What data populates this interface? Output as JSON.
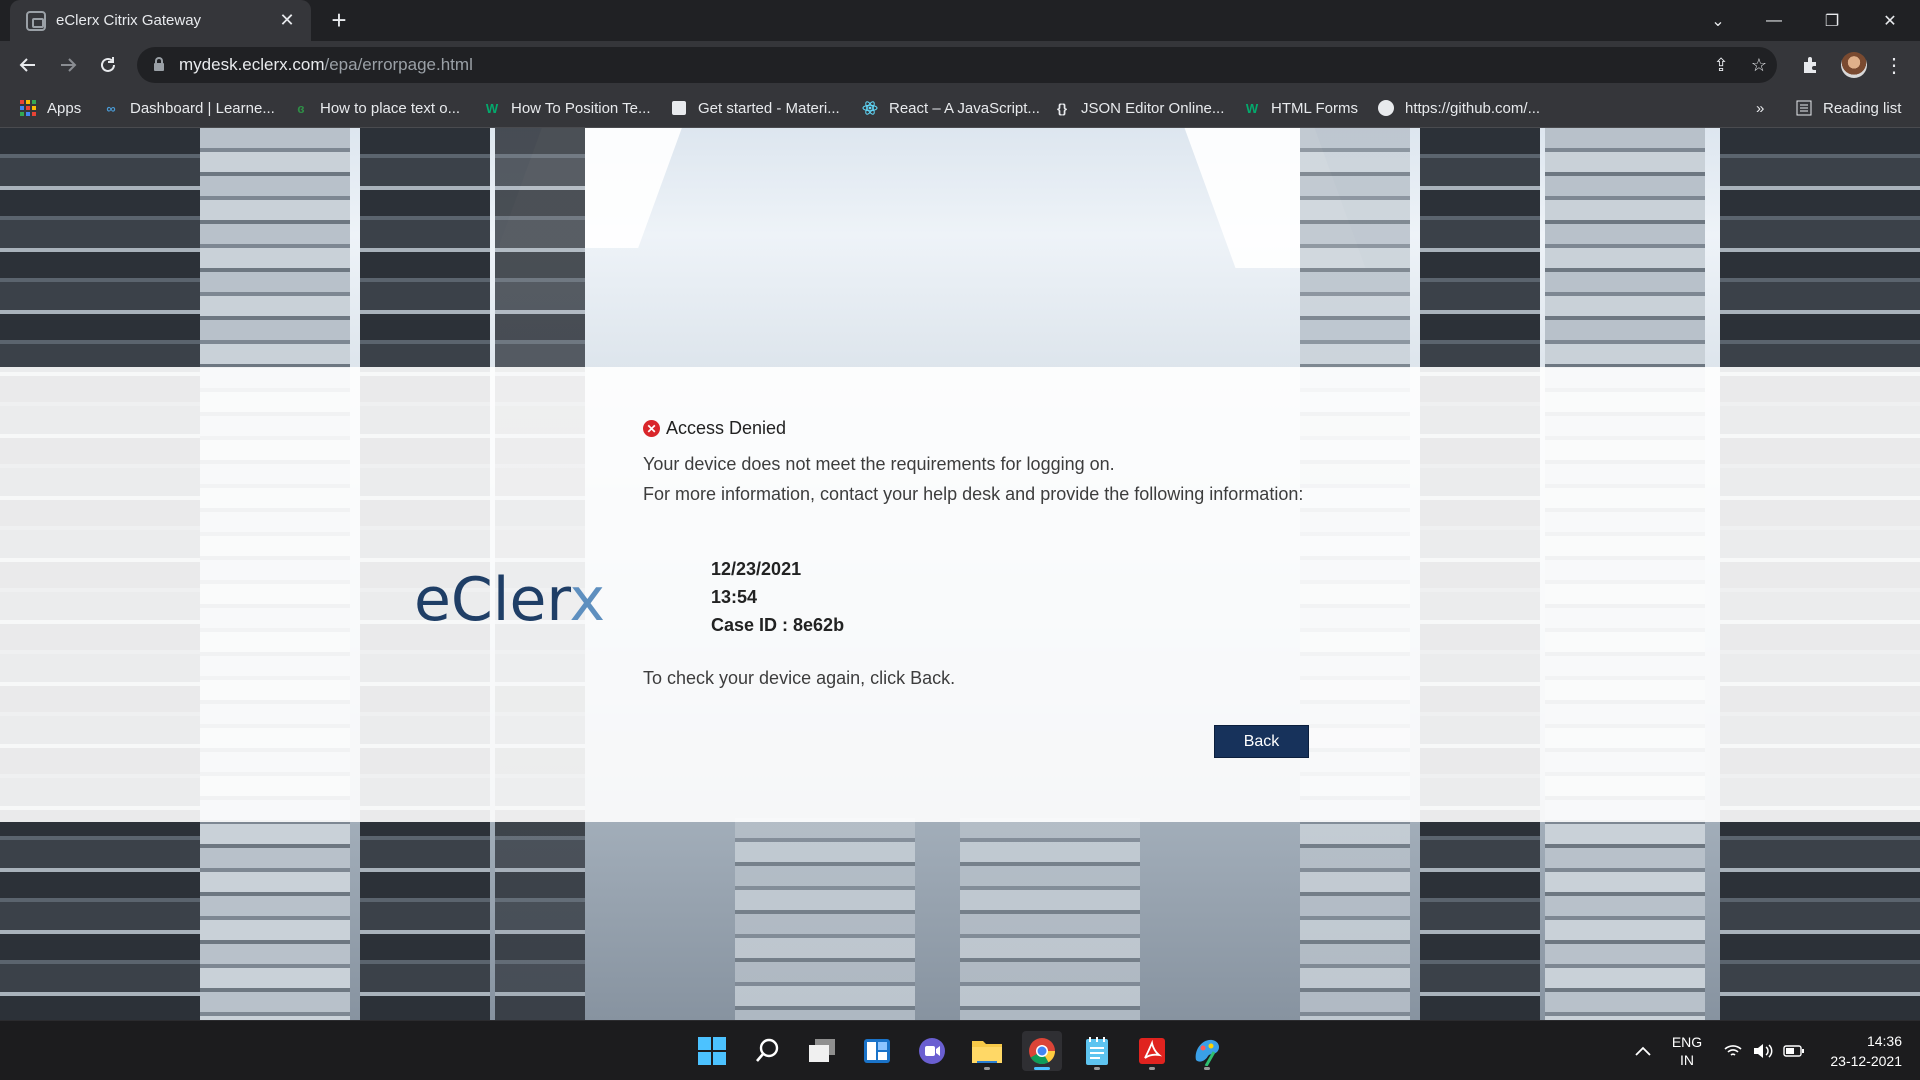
{
  "browser": {
    "tab_title": "eClerx Citrix Gateway",
    "tab_close_glyph": "✕",
    "new_tab_glyph": "+",
    "url_host": "mydesk.eclerx.com",
    "url_path": "/epa/errorpage.html",
    "window_controls": {
      "tabsearch": "⌄",
      "minimize": "—",
      "restore": "❐",
      "close": "✕"
    }
  },
  "bookmarks": {
    "items": [
      {
        "label": "Apps",
        "icon": "apps-grid-icon"
      },
      {
        "label": "Dashboard | Learne...",
        "icon": "infinity-icon"
      },
      {
        "label": "How to place text o...",
        "icon": "geeksforgeeks-icon"
      },
      {
        "label": "How To Position Te...",
        "icon": "w3-icon"
      },
      {
        "label": "Get started - Materi...",
        "icon": "materialize-icon"
      },
      {
        "label": "React – A JavaScript...",
        "icon": "react-icon"
      },
      {
        "label": "JSON Editor Online...",
        "icon": "json-braces-icon"
      },
      {
        "label": "HTML Forms",
        "icon": "w3-icon"
      },
      {
        "label": "https://github.com/...",
        "icon": "github-icon"
      }
    ],
    "more_glyph": "»",
    "reading_list": "Reading list"
  },
  "page": {
    "logo": {
      "main": "eCler",
      "accent": "x"
    },
    "error_title": "Access Denied",
    "line1": "Your device does not meet the requirements for logging on.",
    "line2": "For more information, contact your help desk and provide the following information:",
    "date": "12/23/2021",
    "time": "13:54",
    "case_id": "Case ID : 8e62b",
    "check_again": "To check your device again, click Back.",
    "back_button": "Back",
    "colors": {
      "button": "#17325b",
      "error": "#d9262b",
      "logo": "#1f3e66",
      "logo_accent": "#5e8fbf"
    }
  },
  "taskbar": {
    "apps": [
      "windows-start-icon",
      "search-icon",
      "task-view-icon",
      "widgets-icon",
      "teams-chat-icon",
      "file-explorer-icon",
      "chrome-icon",
      "notepad-icon",
      "acrobat-icon",
      "paint-3d-icon"
    ],
    "language_top": "ENG",
    "language_bottom": "IN",
    "time": "14:36",
    "date": "23-12-2021"
  }
}
